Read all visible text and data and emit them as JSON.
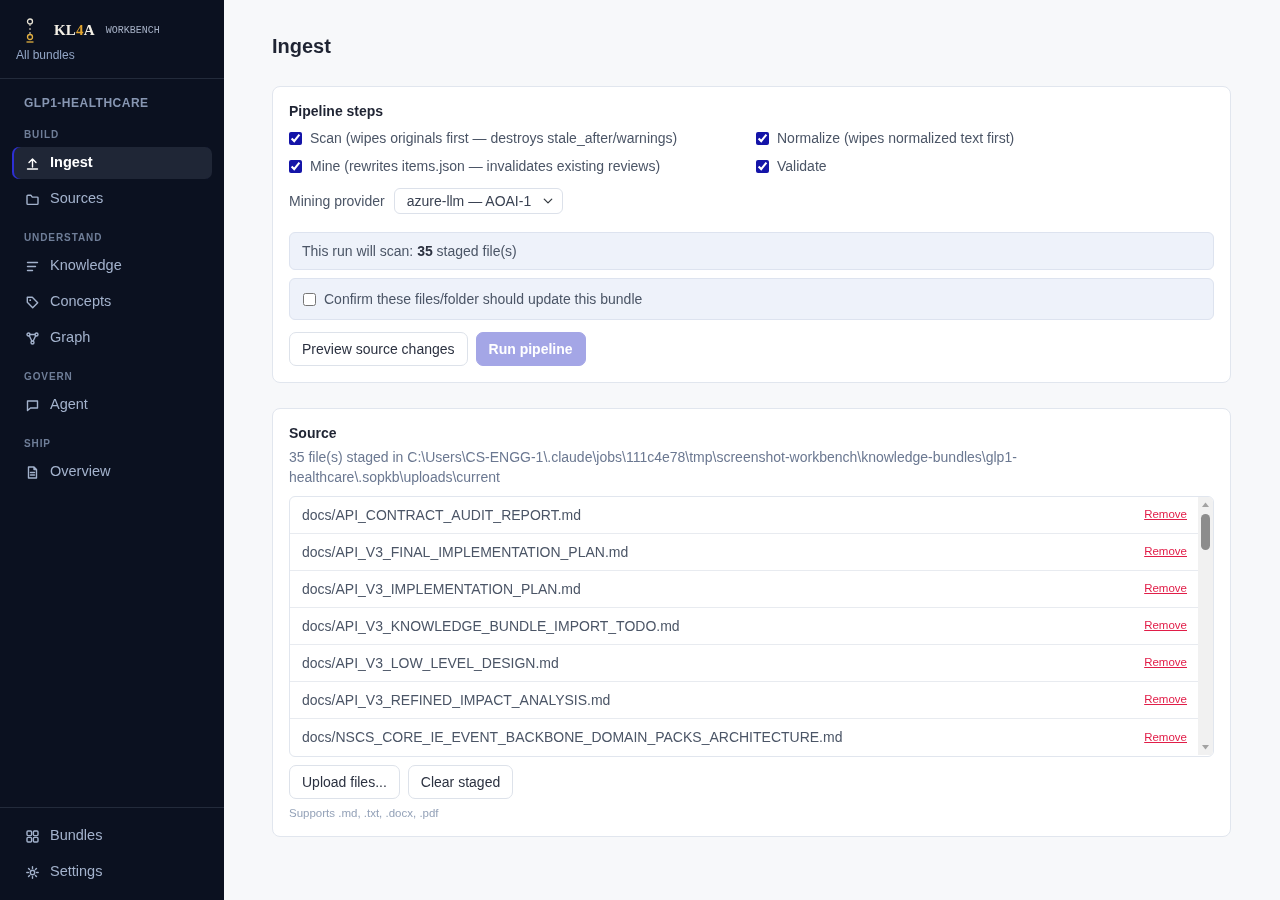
{
  "sidebar": {
    "brand": {
      "name_start": "KL",
      "name_accent": "4",
      "name_end": "A",
      "suffix": "WORKBENCH"
    },
    "back_link": "All bundles",
    "bundle": "GLP1-HEALTHCARE",
    "sections": [
      {
        "label": "BUILD",
        "items": [
          {
            "label": "Ingest",
            "selected": true
          },
          {
            "label": "Sources",
            "selected": false
          }
        ]
      },
      {
        "label": "UNDERSTAND",
        "items": [
          {
            "label": "Knowledge",
            "selected": false
          },
          {
            "label": "Concepts",
            "selected": false
          },
          {
            "label": "Graph",
            "selected": false
          }
        ]
      },
      {
        "label": "GOVERN",
        "items": [
          {
            "label": "Agent",
            "selected": false
          }
        ]
      },
      {
        "label": "SHIP",
        "items": [
          {
            "label": "Overview",
            "selected": false
          }
        ]
      }
    ],
    "footer_items": [
      {
        "label": "Bundles",
        "selected": false
      },
      {
        "label": "Settings",
        "selected": false
      }
    ]
  },
  "page_title": "Ingest",
  "pipeline": {
    "title": "Pipeline steps",
    "steps": [
      {
        "label": "Scan (wipes originals first — destroys stale_after/warnings)",
        "checked": true
      },
      {
        "label": "Normalize (wipes normalized text first)",
        "checked": true
      },
      {
        "label": "Mine (rewrites items.json — invalidates existing reviews)",
        "checked": true
      },
      {
        "label": "Validate",
        "checked": true
      }
    ],
    "provider": {
      "label": "Mining provider",
      "value": "azure-llm — AOAI-1"
    },
    "scan_notice": "This run will scan: **35** staged file(s)",
    "confirm": {
      "label": "Confirm these files/folder should update this bundle",
      "checked": false
    },
    "buttons": [
      {
        "label": "Preview source changes",
        "kind": "secondary",
        "disabled": false
      },
      {
        "label": "Run pipeline",
        "kind": "primary",
        "disabled": true
      }
    ]
  },
  "source": {
    "title": "Source",
    "path_note": "35 file(s) staged in C:\\Users\\CS-ENGG-1\\.claude\\jobs\\111c4e78\\tmp\\screenshot-workbench\\knowledge-bundles\\glp1-healthcare\\.sopkb\\uploads\\current",
    "files": [
      {
        "name": "docs/API_CONTRACT_AUDIT_REPORT.md",
        "action": "Remove"
      },
      {
        "name": "docs/API_V3_FINAL_IMPLEMENTATION_PLAN.md",
        "action": "Remove"
      },
      {
        "name": "docs/API_V3_IMPLEMENTATION_PLAN.md",
        "action": "Remove"
      },
      {
        "name": "docs/API_V3_KNOWLEDGE_BUNDLE_IMPORT_TODO.md",
        "action": "Remove"
      },
      {
        "name": "docs/API_V3_LOW_LEVEL_DESIGN.md",
        "action": "Remove"
      },
      {
        "name": "docs/API_V3_REFINED_IMPACT_ANALYSIS.md",
        "action": "Remove"
      },
      {
        "name": "docs/NSCS_CORE_IE_EVENT_BACKBONE_DOMAIN_PACKS_ARCHITECTURE.md",
        "action": "Remove"
      }
    ],
    "buttons": [
      {
        "label": "Upload files...",
        "kind": "secondary",
        "disabled": false
      },
      {
        "label": "Clear staged",
        "kind": "secondary",
        "disabled": false
      }
    ],
    "hint": "Supports .md, .txt, .docx, .pdf"
  }
}
